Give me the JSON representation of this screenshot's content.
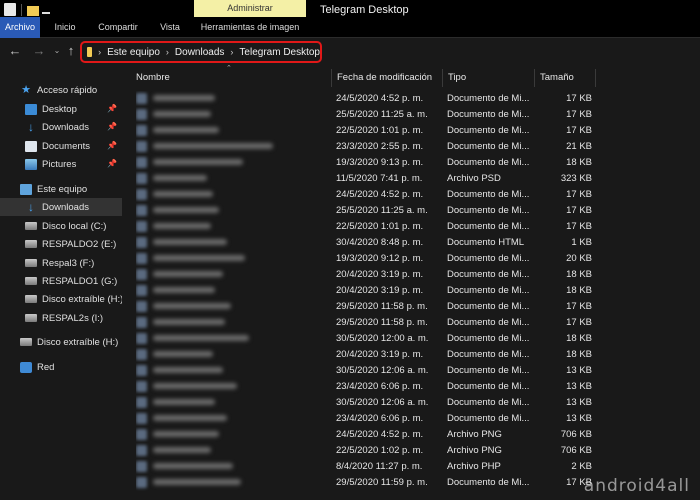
{
  "window": {
    "title": "Telegram Desktop",
    "context_tab": "Administrar"
  },
  "ribbon": {
    "tabs": [
      "Archivo",
      "Inicio",
      "Compartir",
      "Vista",
      "Herramientas de imagen"
    ]
  },
  "address": {
    "breadcrumbs": [
      "Este equipo",
      "Downloads",
      "Telegram Desktop"
    ],
    "highlight_color": "#e01818"
  },
  "nav": {
    "quick_access": "Acceso rápido",
    "desktop": "Desktop",
    "downloads": "Downloads",
    "documents": "Documents",
    "pictures": "Pictures",
    "this_pc": "Este equipo",
    "pc_downloads": "Downloads",
    "disco_local": "Disco local (C:)",
    "respaldo2": "RESPALDO2 (E:)",
    "respal3": "Respal3 (F:)",
    "respaldo1": "RESPALDO1 (G:)",
    "disco_extraible_h": "Disco extraíble (H:)",
    "respal2s": "RESPAL2s (I:)",
    "disco_extraible_h2": "Disco extraíble (H:)",
    "red": "Red"
  },
  "columns": {
    "name": "Nombre",
    "date": "Fecha de modificación",
    "type": "Tipo",
    "size": "Tamaño"
  },
  "files": [
    {
      "date": "24/5/2020 4:52 p. m.",
      "type": "Documento de Mi...",
      "size": "17 KB"
    },
    {
      "date": "25/5/2020 11:25 a. m.",
      "type": "Documento de Mi...",
      "size": "17 KB"
    },
    {
      "date": "22/5/2020 1:01 p. m.",
      "type": "Documento de Mi...",
      "size": "17 KB"
    },
    {
      "date": "23/3/2020 2:55 p. m.",
      "type": "Documento de Mi...",
      "size": "21 KB"
    },
    {
      "date": "19/3/2020 9:13 p. m.",
      "type": "Documento de Mi...",
      "size": "18 KB"
    },
    {
      "date": "11/5/2020 7:41 p. m.",
      "type": "Archivo PSD",
      "size": "323 KB"
    },
    {
      "date": "24/5/2020 4:52 p. m.",
      "type": "Documento de Mi...",
      "size": "17 KB"
    },
    {
      "date": "25/5/2020 11:25 a. m.",
      "type": "Documento de Mi...",
      "size": "17 KB"
    },
    {
      "date": "22/5/2020 1:01 p. m.",
      "type": "Documento de Mi...",
      "size": "17 KB"
    },
    {
      "date": "30/4/2020 8:48 p. m.",
      "type": "Documento HTML",
      "size": "1 KB"
    },
    {
      "date": "19/3/2020 9:12 p. m.",
      "type": "Documento de Mi...",
      "size": "20 KB"
    },
    {
      "date": "20/4/2020 3:19 p. m.",
      "type": "Documento de Mi...",
      "size": "18 KB"
    },
    {
      "date": "20/4/2020 3:19 p. m.",
      "type": "Documento de Mi...",
      "size": "18 KB"
    },
    {
      "date": "29/5/2020 11:58 p. m.",
      "type": "Documento de Mi...",
      "size": "17 KB"
    },
    {
      "date": "29/5/2020 11:58 p. m.",
      "type": "Documento de Mi...",
      "size": "17 KB"
    },
    {
      "date": "30/5/2020 12:00 a. m.",
      "type": "Documento de Mi...",
      "size": "18 KB"
    },
    {
      "date": "20/4/2020 3:19 p. m.",
      "type": "Documento de Mi...",
      "size": "18 KB"
    },
    {
      "date": "30/5/2020 12:06 a. m.",
      "type": "Documento de Mi...",
      "size": "13 KB"
    },
    {
      "date": "23/4/2020 6:06 p. m.",
      "type": "Documento de Mi...",
      "size": "13 KB"
    },
    {
      "date": "30/5/2020 12:06 a. m.",
      "type": "Documento de Mi...",
      "size": "13 KB"
    },
    {
      "date": "23/4/2020 6:06 p. m.",
      "type": "Documento de Mi...",
      "size": "13 KB"
    },
    {
      "date": "24/5/2020 4:52 p. m.",
      "type": "Archivo PNG",
      "size": "706 KB"
    },
    {
      "date": "22/5/2020 1:02 p. m.",
      "type": "Archivo PNG",
      "size": "706 KB"
    },
    {
      "date": "8/4/2020 11:27 p. m.",
      "type": "Archivo PHP",
      "size": "2 KB"
    },
    {
      "date": "29/5/2020 11:59 p. m.",
      "type": "Documento de Mi...",
      "size": "17 KB"
    }
  ],
  "watermark": "android4all",
  "colors": {
    "background": "#191919",
    "selected_tab": "#2a5ab6",
    "context_tab": "#f4f0a6",
    "folder": "#f2cb55"
  }
}
